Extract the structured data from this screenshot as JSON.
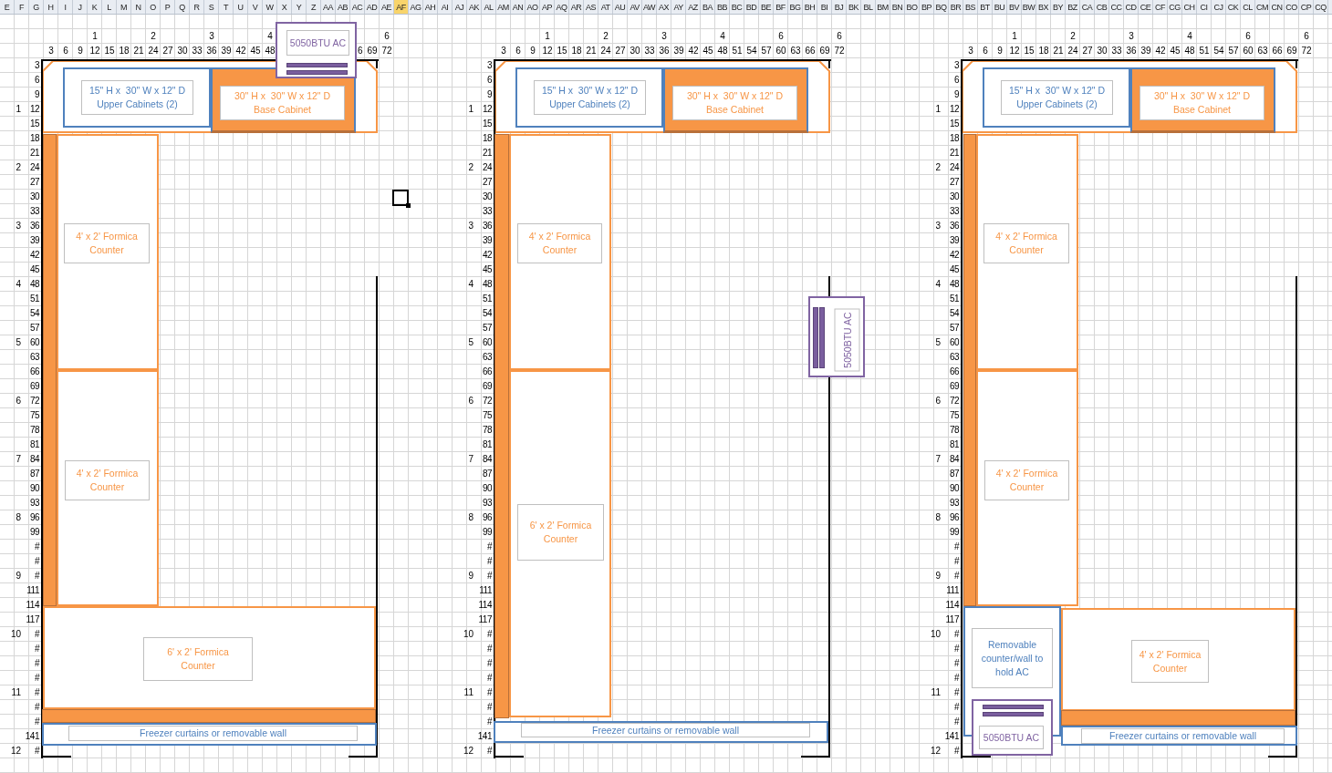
{
  "column_headers": [
    {
      "label": "E",
      "selected": false
    },
    {
      "label": "F",
      "selected": false
    },
    {
      "label": "G",
      "selected": false
    },
    {
      "label": "H",
      "selected": false
    },
    {
      "label": "I",
      "selected": false
    },
    {
      "label": "J",
      "selected": false
    },
    {
      "label": "K",
      "selected": false
    },
    {
      "label": "L",
      "selected": false
    },
    {
      "label": "M",
      "selected": false
    },
    {
      "label": "N",
      "selected": false
    },
    {
      "label": "O",
      "selected": false
    },
    {
      "label": "P",
      "selected": false
    },
    {
      "label": "Q",
      "selected": false
    },
    {
      "label": "R",
      "selected": false
    },
    {
      "label": "S",
      "selected": false
    },
    {
      "label": "T",
      "selected": false
    },
    {
      "label": "U",
      "selected": false
    },
    {
      "label": "V",
      "selected": false
    },
    {
      "label": "W",
      "selected": false
    },
    {
      "label": "X",
      "selected": false
    },
    {
      "label": "Y",
      "selected": false
    },
    {
      "label": "Z",
      "selected": false
    },
    {
      "label": "AA",
      "selected": false
    },
    {
      "label": "AB",
      "selected": false
    },
    {
      "label": "AC",
      "selected": false
    },
    {
      "label": "AD",
      "selected": false
    },
    {
      "label": "AE",
      "selected": false
    },
    {
      "label": "AF",
      "selected": true
    },
    {
      "label": "AG",
      "selected": false
    },
    {
      "label": "AH",
      "selected": false
    },
    {
      "label": "AI",
      "selected": false
    },
    {
      "label": "AJ",
      "selected": false
    },
    {
      "label": "AK",
      "selected": false
    },
    {
      "label": "AL",
      "selected": false
    },
    {
      "label": "AM",
      "selected": false
    },
    {
      "label": "AN",
      "selected": false
    },
    {
      "label": "AO",
      "selected": false
    },
    {
      "label": "AP",
      "selected": false
    },
    {
      "label": "AQ",
      "selected": false
    },
    {
      "label": "AR",
      "selected": false
    },
    {
      "label": "AS",
      "selected": false
    },
    {
      "label": "AT",
      "selected": false
    },
    {
      "label": "AU",
      "selected": false
    },
    {
      "label": "AV",
      "selected": false
    },
    {
      "label": "AW",
      "selected": false
    },
    {
      "label": "AX",
      "selected": false
    },
    {
      "label": "AY",
      "selected": false
    },
    {
      "label": "AZ",
      "selected": false
    },
    {
      "label": "BA",
      "selected": false
    },
    {
      "label": "BB",
      "selected": false
    },
    {
      "label": "BC",
      "selected": false
    },
    {
      "label": "BD",
      "selected": false
    },
    {
      "label": "BE",
      "selected": false
    },
    {
      "label": "BF",
      "selected": false
    },
    {
      "label": "BG",
      "selected": false
    },
    {
      "label": "BH",
      "selected": false
    },
    {
      "label": "BI",
      "selected": false
    },
    {
      "label": "BJ",
      "selected": false
    },
    {
      "label": "BK",
      "selected": false
    },
    {
      "label": "BL",
      "selected": false
    },
    {
      "label": "BM",
      "selected": false
    },
    {
      "label": "BN",
      "selected": false
    },
    {
      "label": "BO",
      "selected": false
    },
    {
      "label": "BP",
      "selected": false
    },
    {
      "label": "BQ",
      "selected": false
    },
    {
      "label": "BR",
      "selected": false
    },
    {
      "label": "BS",
      "selected": false
    },
    {
      "label": "BT",
      "selected": false
    },
    {
      "label": "BU",
      "selected": false
    },
    {
      "label": "BV",
      "selected": false
    },
    {
      "label": "BW",
      "selected": false
    },
    {
      "label": "BX",
      "selected": false
    },
    {
      "label": "BY",
      "selected": false
    },
    {
      "label": "BZ",
      "selected": false
    },
    {
      "label": "CA",
      "selected": false
    },
    {
      "label": "CB",
      "selected": false
    },
    {
      "label": "CC",
      "selected": false
    },
    {
      "label": "CD",
      "selected": false
    },
    {
      "label": "CE",
      "selected": false
    },
    {
      "label": "CF",
      "selected": false
    },
    {
      "label": "CG",
      "selected": false
    },
    {
      "label": "CH",
      "selected": false
    },
    {
      "label": "CI",
      "selected": false
    },
    {
      "label": "CJ",
      "selected": false
    },
    {
      "label": "CK",
      "selected": false
    },
    {
      "label": "CL",
      "selected": false
    },
    {
      "label": "CM",
      "selected": false
    },
    {
      "label": "CN",
      "selected": false
    },
    {
      "label": "CO",
      "selected": false
    },
    {
      "label": "CP",
      "selected": false
    },
    {
      "label": "CQ",
      "selected": false
    }
  ],
  "plans": [
    {
      "ruler_feet": [
        "1",
        "2",
        "3",
        "4",
        "6"
      ],
      "ruler_inches": [
        "3",
        "6",
        "9",
        "12",
        "15",
        "18",
        "21",
        "24",
        "27",
        "30",
        "33",
        "36",
        "39",
        "42",
        "45",
        "48",
        "6",
        "69",
        "72"
      ],
      "row_feet": [
        "1",
        "2",
        "3",
        "4",
        "5",
        "6",
        "7",
        "8",
        "9",
        "10",
        "11",
        "12"
      ],
      "row_inches": [
        "3",
        "6",
        "9",
        "12",
        "15",
        "18",
        "21",
        "24",
        "27",
        "30",
        "33",
        "36",
        "39",
        "42",
        "45",
        "48",
        "51",
        "54",
        "57",
        "60",
        "63",
        "66",
        "69",
        "72",
        "75",
        "78",
        "81",
        "84",
        "87",
        "90",
        "93",
        "96",
        "99",
        "#",
        "#",
        "#",
        "111",
        "114",
        "117",
        "#",
        "#",
        "#",
        "#",
        "#",
        "#",
        "#",
        "141",
        "#"
      ],
      "shapes": [
        {
          "kind": "ac-unit",
          "label": "5050BTU AC"
        },
        {
          "kind": "counter-top"
        },
        {
          "kind": "upper-cabinet",
          "label": "15\" H x  30\" W x 12\" D\nUpper Cabinets (2)"
        },
        {
          "kind": "base-cabinet",
          "label": "30\" H x  30\" W x 12\" D\nBase Cabinet"
        },
        {
          "kind": "counter-edge"
        },
        {
          "kind": "counter",
          "label": "4' x 2' Formica\nCounter"
        },
        {
          "kind": "counter",
          "label": "4' x 2' Formica\nCounter"
        },
        {
          "kind": "counter",
          "label": "6' x 2' Formica\nCounter"
        },
        {
          "kind": "counter-edge"
        },
        {
          "kind": "curtain",
          "label": "Freezer curtains or removable wall"
        }
      ]
    },
    {
      "ruler_feet": [
        "1",
        "2",
        "3",
        "4",
        "6",
        "6"
      ],
      "ruler_inches": [
        "3",
        "6",
        "9",
        "12",
        "15",
        "18",
        "21",
        "24",
        "27",
        "30",
        "33",
        "36",
        "39",
        "42",
        "45",
        "48",
        "51",
        "54",
        "57",
        "60",
        "63",
        "66",
        "69",
        "72"
      ],
      "row_feet": [
        "1",
        "2",
        "3",
        "4",
        "5",
        "6",
        "7",
        "8",
        "9",
        "10",
        "11",
        "12"
      ],
      "row_inches": [
        "3",
        "6",
        "9",
        "12",
        "15",
        "18",
        "21",
        "24",
        "27",
        "30",
        "33",
        "36",
        "39",
        "42",
        "45",
        "48",
        "51",
        "54",
        "57",
        "60",
        "63",
        "66",
        "69",
        "72",
        "75",
        "78",
        "81",
        "84",
        "87",
        "90",
        "93",
        "96",
        "99",
        "#",
        "#",
        "#",
        "111",
        "114",
        "117",
        "#",
        "#",
        "#",
        "#",
        "#",
        "#",
        "#",
        "141",
        "#"
      ],
      "shapes": [
        {
          "kind": "counter-top"
        },
        {
          "kind": "upper-cabinet",
          "label": "15\" H x  30\" W x 12\" D\nUpper Cabinets (2)"
        },
        {
          "kind": "base-cabinet",
          "label": "30\" H x  30\" W x 12\" D\nBase Cabinet"
        },
        {
          "kind": "counter-edge"
        },
        {
          "kind": "counter",
          "label": "4' x 2' Formica\nCounter"
        },
        {
          "kind": "counter",
          "label": "6' x 2' Formica\nCounter"
        },
        {
          "kind": "ac-unit",
          "label": "5050BTU AC"
        },
        {
          "kind": "curtain",
          "label": "Freezer curtains or removable wall"
        }
      ]
    },
    {
      "ruler_feet": [
        "1",
        "2",
        "3",
        "4",
        "6",
        "6"
      ],
      "ruler_inches": [
        "3",
        "6",
        "9",
        "12",
        "15",
        "18",
        "21",
        "24",
        "27",
        "30",
        "33",
        "36",
        "39",
        "42",
        "45",
        "48",
        "51",
        "54",
        "57",
        "60",
        "63",
        "66",
        "69",
        "72"
      ],
      "row_feet": [
        "1",
        "2",
        "3",
        "4",
        "5",
        "6",
        "7",
        "8",
        "9",
        "10",
        "11",
        "12"
      ],
      "row_inches": [
        "3",
        "6",
        "9",
        "12",
        "15",
        "18",
        "21",
        "24",
        "27",
        "30",
        "33",
        "36",
        "39",
        "42",
        "45",
        "48",
        "51",
        "54",
        "57",
        "60",
        "63",
        "66",
        "69",
        "72",
        "75",
        "78",
        "81",
        "84",
        "87",
        "90",
        "93",
        "96",
        "99",
        "#",
        "#",
        "#",
        "111",
        "114",
        "117",
        "#",
        "#",
        "#",
        "#",
        "#",
        "#",
        "#",
        "141",
        "#"
      ],
      "shapes": [
        {
          "kind": "counter-top"
        },
        {
          "kind": "upper-cabinet",
          "label": "15\" H x  30\" W x 12\" D\nUpper Cabinets (2)"
        },
        {
          "kind": "base-cabinet",
          "label": "30\" H x  30\" W x 12\" D\nBase Cabinet"
        },
        {
          "kind": "counter-edge"
        },
        {
          "kind": "counter",
          "label": "4' x 2' Formica\nCounter"
        },
        {
          "kind": "counter",
          "label": "4' x 2' Formica\nCounter"
        },
        {
          "kind": "removable-wall",
          "label": "Removable counter/wall to hold AC"
        },
        {
          "kind": "ac-unit",
          "label": "5050BTU AC"
        },
        {
          "kind": "counter",
          "label": "4' x 2' Formica\nCounter"
        },
        {
          "kind": "counter-edge"
        },
        {
          "kind": "curtain",
          "label": "Freezer curtains or removable wall"
        }
      ]
    }
  ]
}
